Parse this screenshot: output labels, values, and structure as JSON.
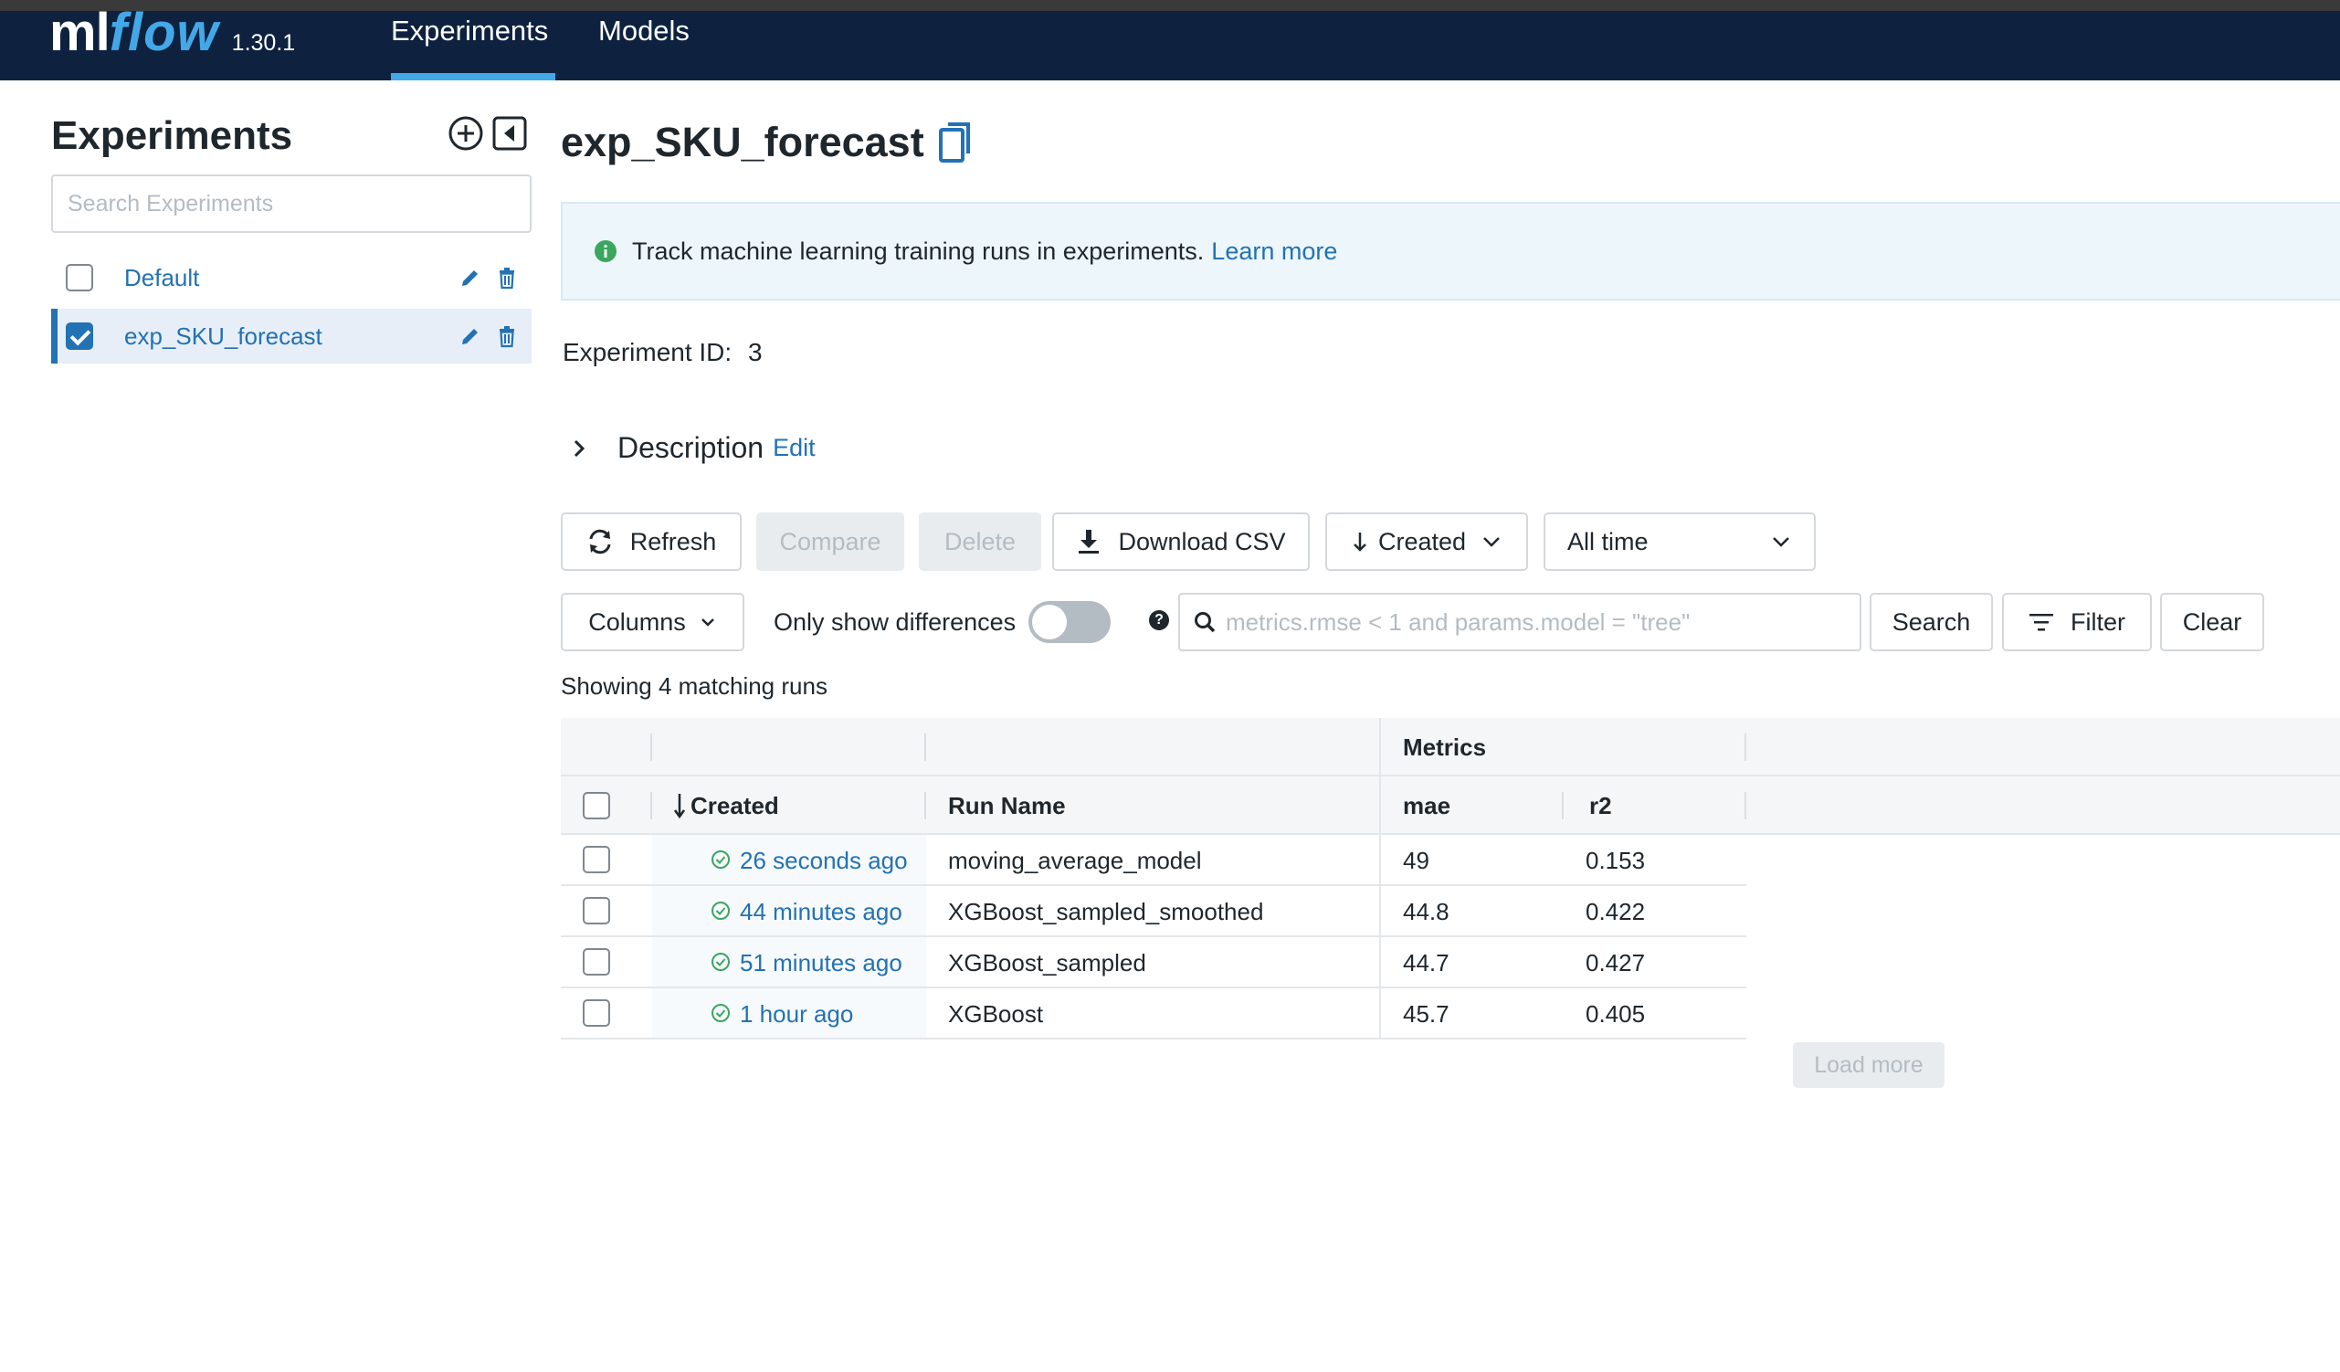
{
  "header": {
    "logo_ml": "ml",
    "logo_flow": "flow",
    "version": "1.30.1",
    "nav": [
      {
        "label": "Experiments",
        "active": true
      },
      {
        "label": "Models",
        "active": false
      }
    ]
  },
  "sidebar": {
    "title": "Experiments",
    "search_placeholder": "Search Experiments",
    "items": [
      {
        "label": "Default",
        "checked": false
      },
      {
        "label": "exp_SKU_forecast",
        "checked": true
      }
    ]
  },
  "main": {
    "title": "exp_SKU_forecast",
    "banner_text": "Track machine learning training runs in experiments.",
    "banner_link": "Learn more",
    "experiment_id_label": "Experiment ID:",
    "experiment_id_value": "3",
    "description_label": "Description",
    "description_edit": "Edit"
  },
  "toolbar": {
    "refresh": "Refresh",
    "compare": "Compare",
    "delete": "Delete",
    "download_csv": "Download CSV",
    "sort": "Created",
    "time_range": "All time",
    "columns": "Columns",
    "only_show_differences": "Only show differences",
    "search_placeholder": "metrics.rmse < 1 and params.model = \"tree\"",
    "search": "Search",
    "filter": "Filter",
    "clear": "Clear"
  },
  "table": {
    "showing": "Showing 4 matching runs",
    "group_header": "Metrics",
    "columns": {
      "created": "Created",
      "run_name": "Run Name",
      "mae": "mae",
      "r2": "r2"
    },
    "rows": [
      {
        "created": "26 seconds ago",
        "run_name": "moving_average_model",
        "mae": "49",
        "r2": "0.153"
      },
      {
        "created": "44 minutes ago",
        "run_name": "XGBoost_sampled_smoothed",
        "mae": "44.8",
        "r2": "0.422"
      },
      {
        "created": "51 minutes ago",
        "run_name": "XGBoost_sampled",
        "mae": "44.7",
        "r2": "0.427"
      },
      {
        "created": "1 hour ago",
        "run_name": "XGBoost",
        "mae": "45.7",
        "r2": "0.405"
      }
    ],
    "load_more": "Load more"
  },
  "colors": {
    "header_bg": "#0e2240",
    "accent": "#2272b4",
    "logo_flow": "#43a8e8",
    "success": "#3ba65e"
  }
}
